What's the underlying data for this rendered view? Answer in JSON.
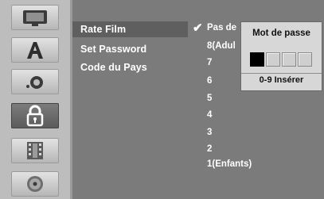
{
  "icons": [
    {
      "name": "display-icon",
      "active": false
    },
    {
      "name": "language-icon",
      "active": false
    },
    {
      "name": "audio-icon",
      "active": false
    },
    {
      "name": "lock-icon",
      "active": true
    },
    {
      "name": "film-icon",
      "active": false
    },
    {
      "name": "disc-icon",
      "active": false
    }
  ],
  "menu": {
    "items": [
      {
        "label": "Rate Film",
        "selected": true
      },
      {
        "label": "Set Password",
        "selected": false
      },
      {
        "label": "Code du Pays",
        "selected": false
      }
    ]
  },
  "ratings": {
    "checked_index": 0,
    "items": [
      "Pas de",
      "8(Adul",
      "7",
      "6",
      "5",
      "4",
      "3",
      "2",
      "1(Enfants)"
    ]
  },
  "password_popup": {
    "title": "Mot de passe",
    "digits_entered": 1,
    "digits_total": 4,
    "hint": "0-9 Insérer"
  },
  "colors": {
    "panel": "#7b7b7b",
    "icon_panel": "#bdbdbd",
    "highlight": "#5f5f5f",
    "text": "#ffffff",
    "popup_bg": "#d7d7d7"
  }
}
